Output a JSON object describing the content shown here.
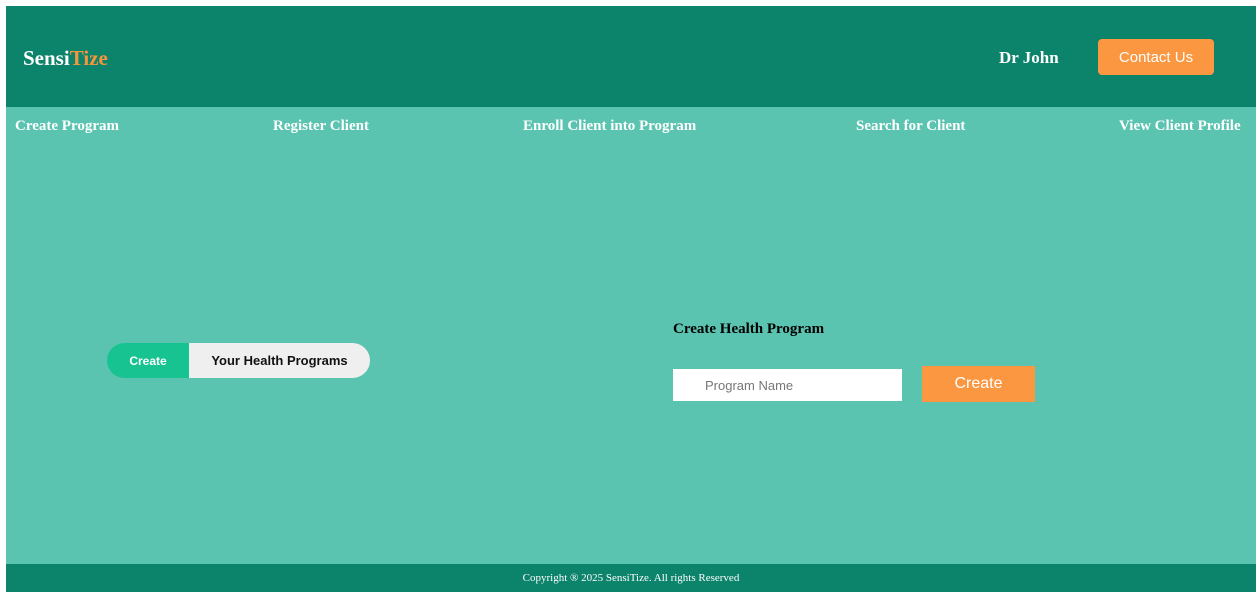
{
  "header": {
    "brand_part1": "Sensi",
    "brand_part2": "Tize",
    "user_name": "Dr John",
    "contact_label": "Contact Us"
  },
  "nav": {
    "items": [
      {
        "label": "Create Program"
      },
      {
        "label": "Register Client"
      },
      {
        "label": "Enroll Client into Program"
      },
      {
        "label": "Search for Client"
      },
      {
        "label": "View Client Profile"
      }
    ]
  },
  "toggle": {
    "create_label": "Create",
    "programs_label": "Your Health Programs"
  },
  "form": {
    "title": "Create Health Program",
    "program_name_placeholder": "Program Name",
    "program_name_value": "",
    "create_label": "Create"
  },
  "footer": {
    "copyright": "Copyright ® 2025 SensiTize. All rights Reserved"
  },
  "colors": {
    "header_bg": "#0c836b",
    "page_bg": "#5bc4b0",
    "accent_orange": "#fb9641",
    "toggle_active": "#16c391"
  }
}
